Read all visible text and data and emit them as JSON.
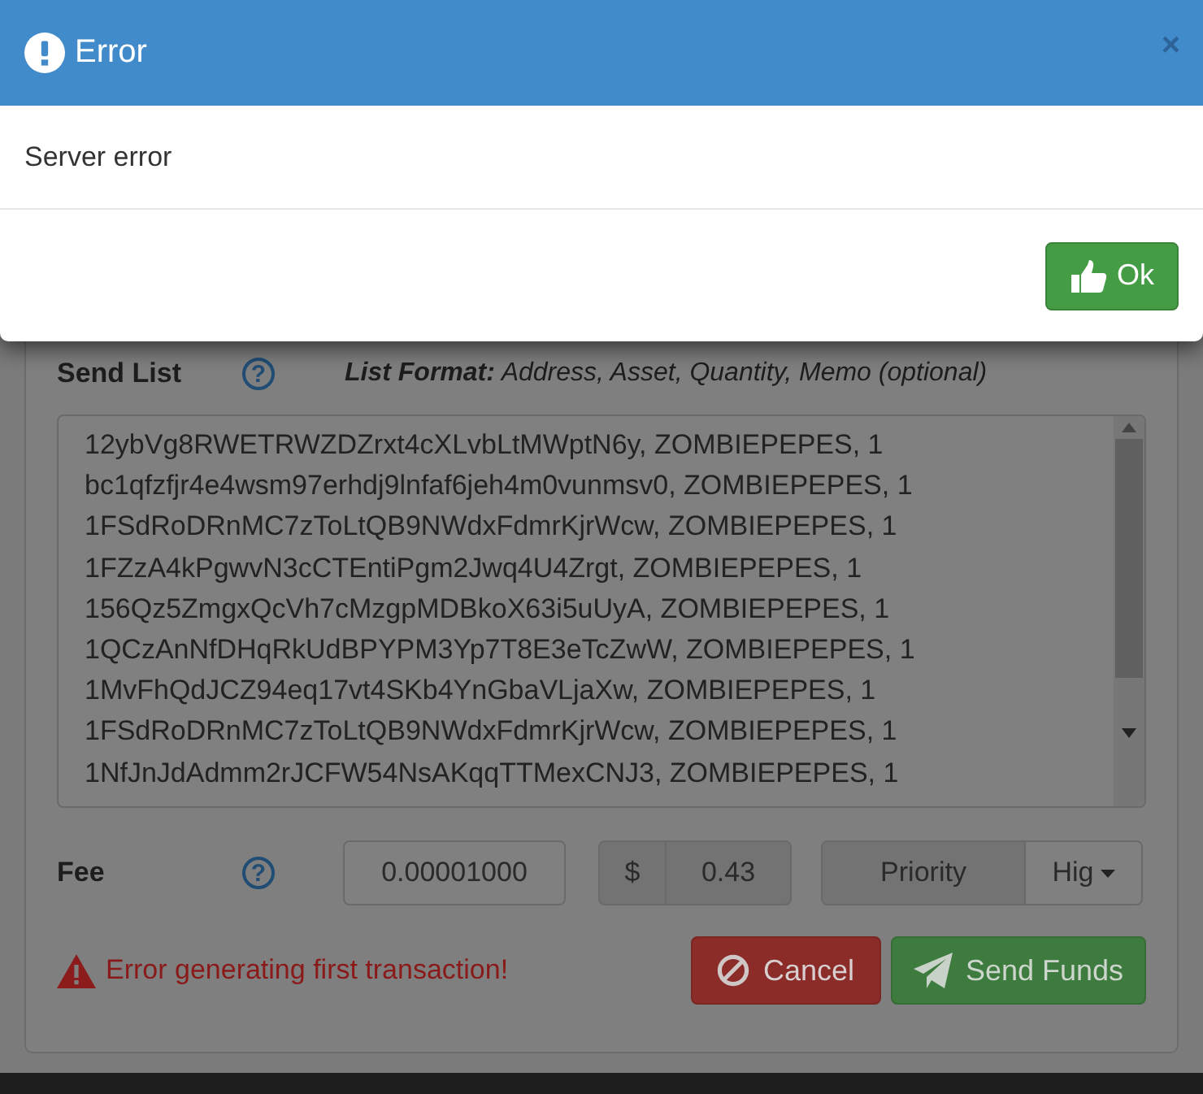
{
  "modal": {
    "title": "Error",
    "close": "×",
    "message": "Server error",
    "ok_button": "Ok"
  },
  "send_form": {
    "send_list_label": "Send List",
    "send_list_help": "?",
    "list_format_label": "List Format:",
    "list_format": "Address, Asset, Quantity, Memo (optional)",
    "lines": [
      "12ybVg8RWETRWZDZrxt4cXLvbLtMWptN6y, ZOMBIEPEPES, 1",
      "bc1qfzfjr4e4wsm97erhdj9lnfaf6jeh4m0vunmsv0, ZOMBIEPEPES, 1",
      "1FSdRoDRnMC7zToLtQB9NWdxFdmrKjrWcw, ZOMBIEPEPES, 1",
      "1FZzA4kPgwvN3cCTEntiPgm2Jwq4U4Zrgt, ZOMBIEPEPES, 1",
      "156Qz5ZmgxQcVh7cMzgpMDBkoX63i5uUyA, ZOMBIEPEPES, 1",
      "1QCzAnNfDHqRkUdBPYPM3Yp7T8E3eTcZwW, ZOMBIEPEPES, 1",
      "1MvFhQdJCZ94eq17vt4SKb4YnGbaVLjaXw, ZOMBIEPEPES, 1",
      "1FSdRoDRnMC7zToLtQB9NWdxFdmrKjrWcw, ZOMBIEPEPES, 1",
      "1NfJnJdAdmm2rJCFW54NsAKqqTTMexCNJ3, ZOMBIEPEPES, 1"
    ],
    "fee_label": "Fee",
    "fee_help": "?",
    "fee": "0.00001000",
    "currency": "$",
    "fee_usd": "0.43",
    "priority_label": "Priority",
    "priority": "Hig",
    "error": "Error generating first transaction!",
    "cancel_button": "Cancel",
    "send_button": "Send Funds"
  }
}
